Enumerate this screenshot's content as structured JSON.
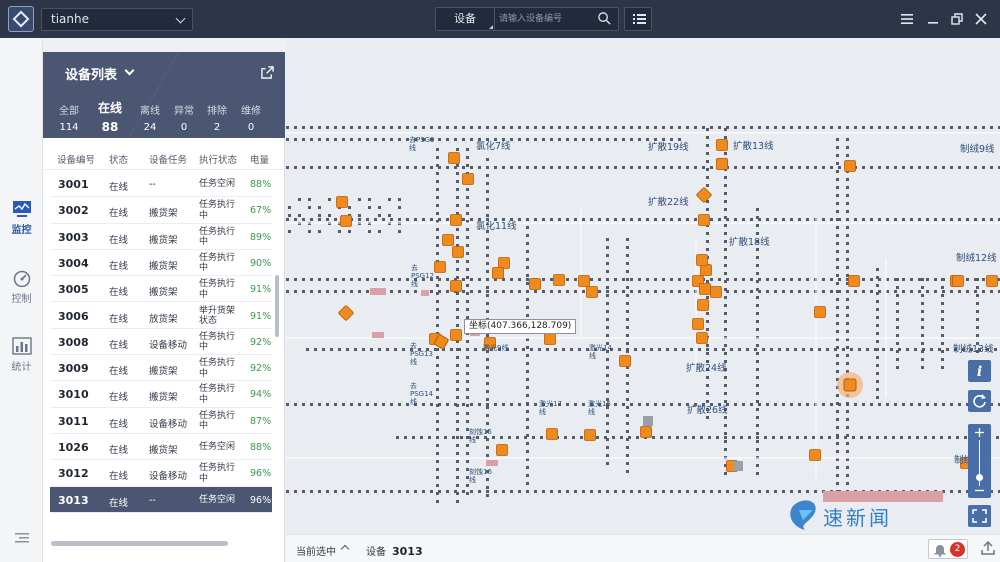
{
  "header": {
    "project": "tianhe",
    "search_type": "设备",
    "search_placeholder": "请输入设备编号"
  },
  "rail": {
    "items": [
      {
        "label": "监控",
        "icon": "monitor-icon",
        "active": true
      },
      {
        "label": "控制",
        "icon": "gauge-icon",
        "active": false
      },
      {
        "label": "统计",
        "icon": "bar-chart-icon",
        "active": false
      }
    ]
  },
  "panel": {
    "title": "设备列表",
    "stats": [
      {
        "label": "全部",
        "value": "114"
      },
      {
        "label": "在线",
        "value": "88"
      },
      {
        "label": "离线",
        "value": "24"
      },
      {
        "label": "异常",
        "value": "0"
      },
      {
        "label": "排除",
        "value": "2"
      },
      {
        "label": "维修",
        "value": "0"
      }
    ],
    "columns": [
      "设备编号",
      "状态",
      "设备任务",
      "执行状态",
      "电量"
    ],
    "rows": [
      {
        "id": "3001",
        "status": "在线",
        "task": "--",
        "exec": "任务空闲",
        "battery": "88%"
      },
      {
        "id": "3002",
        "status": "在线",
        "task": "搬货架",
        "exec": "任务执行中",
        "battery": "67%"
      },
      {
        "id": "3003",
        "status": "在线",
        "task": "搬货架",
        "exec": "任务执行中",
        "battery": "89%"
      },
      {
        "id": "3004",
        "status": "在线",
        "task": "搬货架",
        "exec": "任务执行中",
        "battery": "90%"
      },
      {
        "id": "3005",
        "status": "在线",
        "task": "搬货架",
        "exec": "任务执行中",
        "battery": "91%"
      },
      {
        "id": "3006",
        "status": "在线",
        "task": "放货架",
        "exec": "举升货架状态",
        "battery": "91%"
      },
      {
        "id": "3008",
        "status": "在线",
        "task": "设备移动",
        "exec": "任务执行中",
        "battery": "92%"
      },
      {
        "id": "3009",
        "status": "在线",
        "task": "搬货架",
        "exec": "任务执行中",
        "battery": "92%"
      },
      {
        "id": "3010",
        "status": "在线",
        "task": "搬货架",
        "exec": "任务执行中",
        "battery": "94%"
      },
      {
        "id": "3011",
        "status": "在线",
        "task": "设备移动",
        "exec": "任务执行中",
        "battery": "87%"
      },
      {
        "id": "1026",
        "status": "在线",
        "task": "搬货架",
        "exec": "任务空闲",
        "battery": "88%"
      },
      {
        "id": "3012",
        "status": "在线",
        "task": "设备移动",
        "exec": "任务执行中",
        "battery": "96%"
      },
      {
        "id": "3013",
        "status": "在线",
        "task": "--",
        "exec": "任务空闲",
        "battery": "96%"
      }
    ]
  },
  "map": {
    "coord_tooltip": "坐标(407.366,128.709)",
    "lines": [
      "氯化7线",
      "扩散19线",
      "扩散13线",
      "制绒9线",
      "扩散22线",
      "氯化11线",
      "扩散18线",
      "制绒12线",
      "扩散24线",
      "制绒13线",
      "扩散26线",
      "制绒"
    ],
    "small_labels": [
      "去PSG9线",
      "去PSG12线",
      "去PSG13线",
      "去PSG14线",
      "激光9线",
      "激光14线",
      "激光17线",
      "激光15线",
      "刻蚀15线",
      "刻蚀16线"
    ]
  },
  "status": {
    "current_selected": "当前选中",
    "device_label": "设备",
    "device_id": "3013",
    "alarm_count": "2"
  },
  "watermark": "速新闻"
}
